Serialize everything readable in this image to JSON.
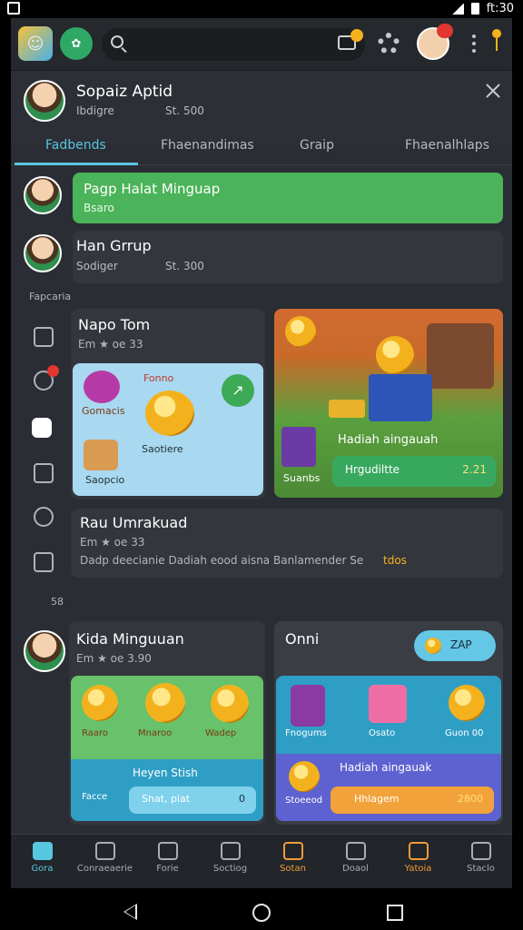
{
  "status_time": "ft:30",
  "colors": {
    "accent": "#58c7e0",
    "green": "#4bb359",
    "orange": "#f19b38",
    "badge_red": "#e2362e",
    "coin": "#f3b21d"
  },
  "topbar": {
    "search_placeholder": "",
    "avatar_badge": ""
  },
  "profile": {
    "name": "Sopaiz Aptid",
    "meta1": "Ibdigre",
    "meta2": "St. 500"
  },
  "tabs": [
    "Fadbends",
    "Fhaenandimas",
    "Graip",
    "Fhaenalhlaps"
  ],
  "groups": [
    {
      "title": "Pagp Halat Minguap",
      "subtitle": "Bsaro"
    },
    {
      "title": "Han Grrup",
      "meta1": "Sodiger",
      "meta2": "St. 300"
    }
  ],
  "section1": {
    "label": "Fapcaria"
  },
  "cards": {
    "napo": {
      "title": "Napo Tom",
      "meta": "Em ★ oe 33",
      "items": [
        "Gomacis",
        "Saotiere",
        "Saopcio"
      ],
      "emoji_label": "Fonno"
    },
    "hadiah1": {
      "title": "Hadiah aingauah",
      "btn": "Hrgudiltte",
      "left": "Suanbs",
      "value": "2.21"
    },
    "rau": {
      "title": "Rau Umrakuad",
      "meta": "Em ★ oe 33",
      "text": "Dadp deecianie Dadiah eood aisna Banlamender Se",
      "tag": "tdos"
    }
  },
  "section2": {
    "label": "58"
  },
  "row3": {
    "left": {
      "title": "Kida Minguuan",
      "meta": "Em ★ oe 3.90",
      "chips": [
        "Raaro",
        "Mnaroo",
        "Wadep"
      ],
      "bar_title": "Heyen Stish",
      "bar_left": "Facce",
      "bar_mid": "Shat, piat",
      "bar_val": "0"
    },
    "right": {
      "title": "Onni",
      "pill": "ZAP",
      "items": [
        "Fnogums",
        "Osato",
        "Guon 00"
      ],
      "bar_title": "Hadiah aingauak",
      "bar_left": "Stoeeod",
      "bar_mid": "Hhlagem",
      "bar_val": "2800"
    }
  },
  "nav": [
    "Gora",
    "Conraeaerie",
    "Forie",
    "Soctiog",
    "Sotan",
    "Doaol",
    "Yatoia",
    "Staclo"
  ]
}
